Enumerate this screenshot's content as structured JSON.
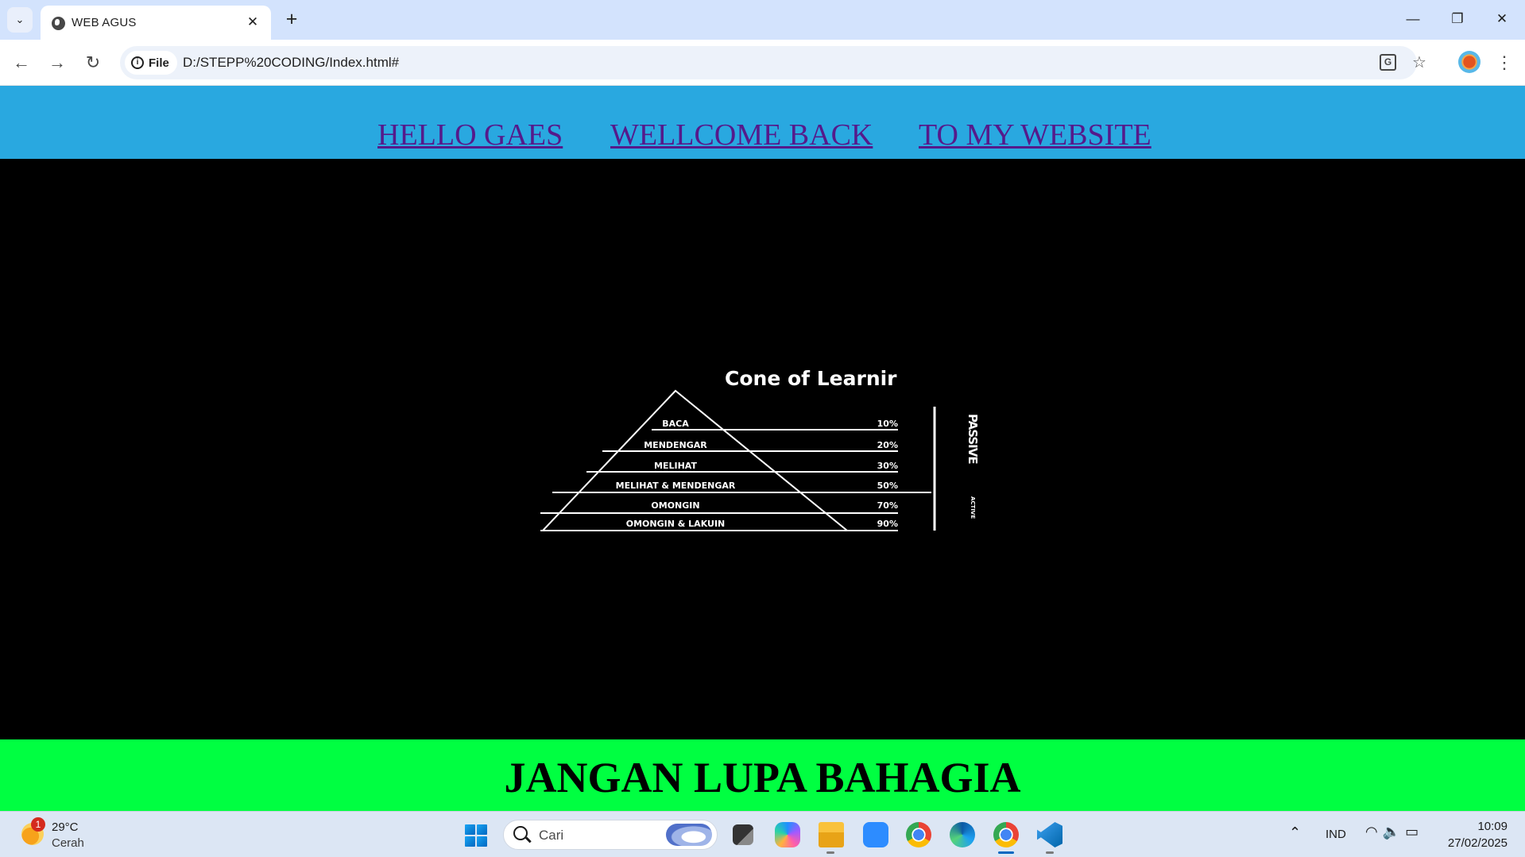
{
  "browser": {
    "tab_title": "WEB AGUS",
    "tab_close": "✕",
    "new_tab": "+",
    "site_chip_label": "File",
    "url": "D:/STEPP%20CODING/Index.html#",
    "window_controls": {
      "minimize": "—",
      "restore": "❐",
      "close": "✕"
    }
  },
  "nav_links": [
    "HELLO GAES",
    "WELLCOME BACK",
    "TO MY WEBSITE"
  ],
  "link_color": "#551a8b",
  "header_bg": "#29a8e0",
  "image": {
    "title": "Cone of Learnir",
    "levels": [
      {
        "label": "BACA",
        "percent": "10%"
      },
      {
        "label": "MENDENGAR",
        "percent": "20%"
      },
      {
        "label": "MELIHAT",
        "percent": "30%"
      },
      {
        "label": "MELIHAT & MENDENGAR",
        "percent": "50%"
      },
      {
        "label": "OMONGIN",
        "percent": "70%"
      },
      {
        "label": "OMONGIN & LAKUIN",
        "percent": "90%"
      }
    ],
    "side_labels": {
      "passive": "PASSIVE",
      "active": "ACTIVE"
    }
  },
  "footer": {
    "text": "JANGAN LUPA BAHAGIA",
    "bg": "#00ff41"
  },
  "taskbar": {
    "weather_temp": "29°C",
    "weather_desc": "Cerah",
    "weather_badge": "1",
    "search_placeholder": "Cari",
    "language": "IND",
    "time": "10:09",
    "date": "27/02/2025",
    "apps": [
      "task-view",
      "copilot",
      "file-explorer",
      "zoom",
      "chrome",
      "edge",
      "chrome-active",
      "vscode"
    ]
  }
}
